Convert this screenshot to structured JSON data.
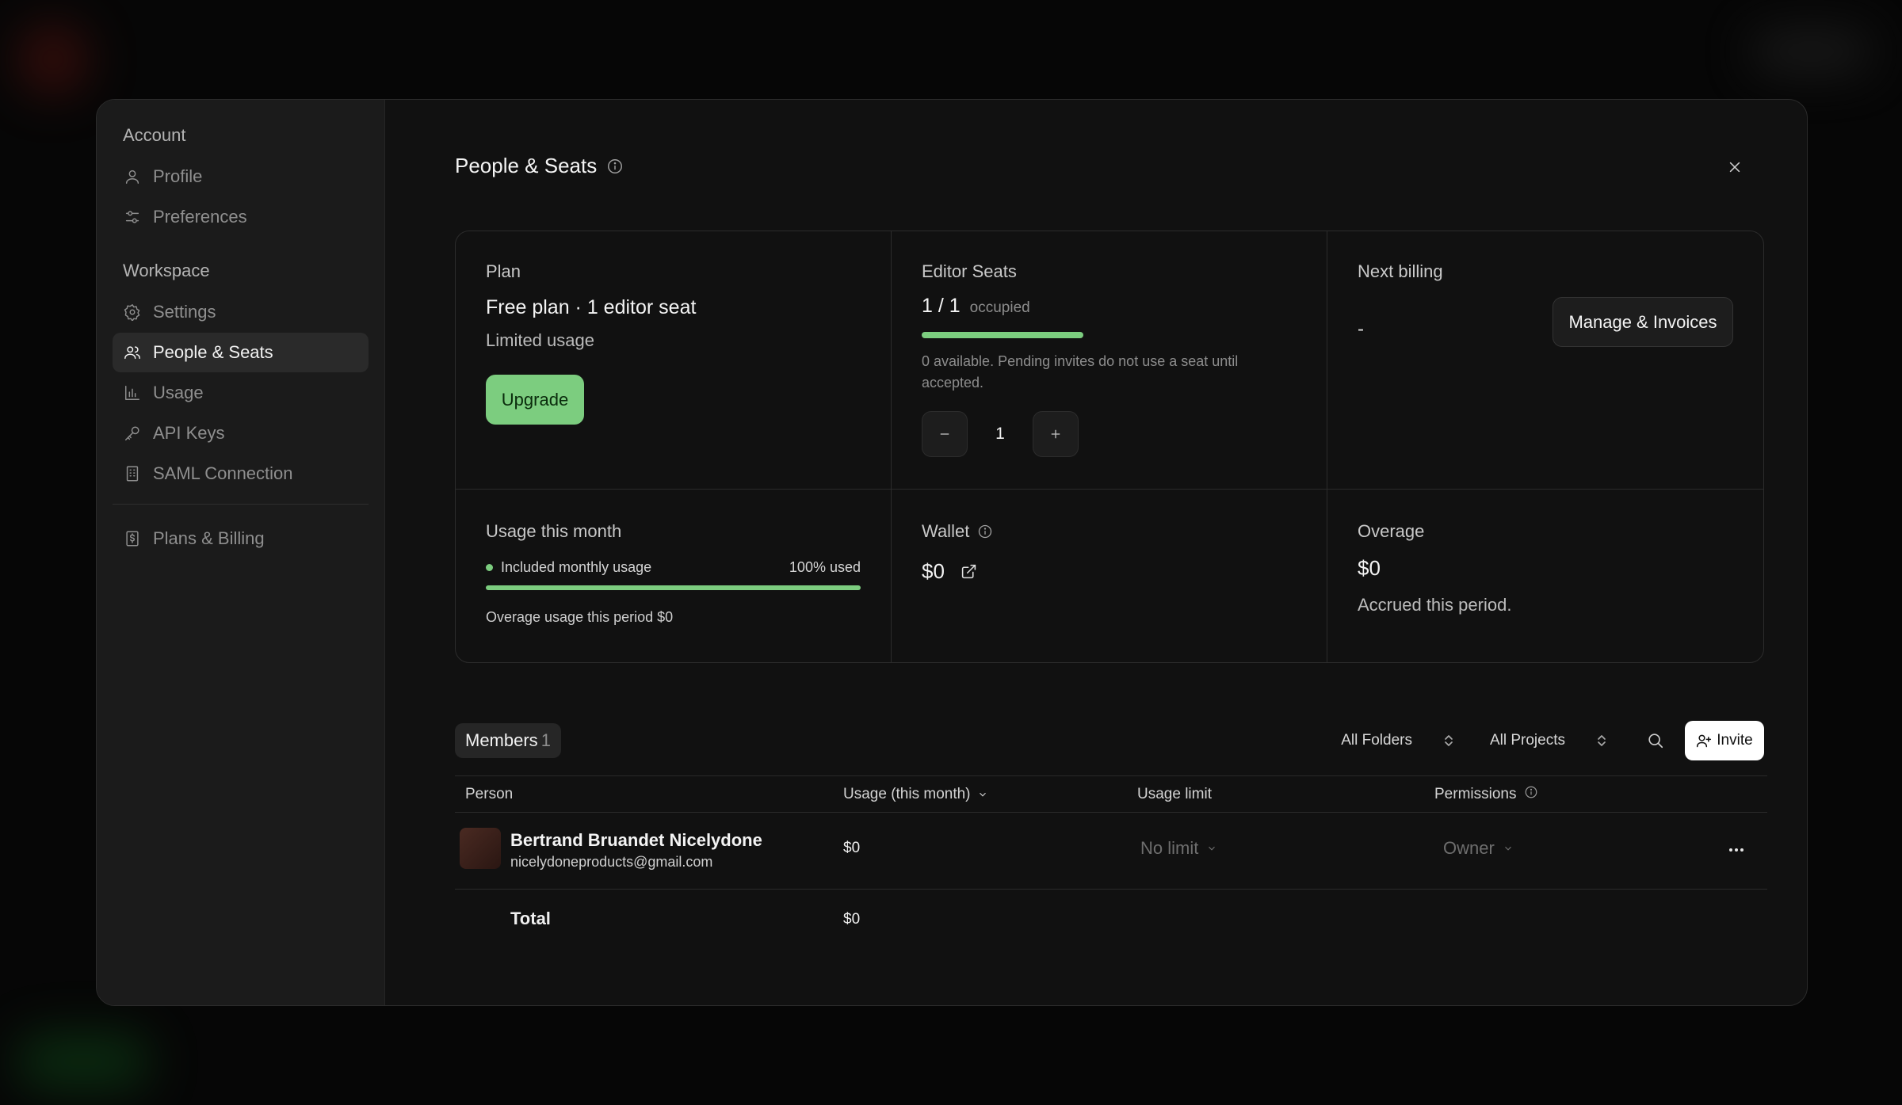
{
  "sidebar": {
    "account_heading": "Account",
    "workspace_heading": "Workspace",
    "account_items": [
      {
        "label": "Profile",
        "icon": "user-icon"
      },
      {
        "label": "Preferences",
        "icon": "sliders-icon"
      }
    ],
    "workspace_items": [
      {
        "label": "Settings",
        "icon": "gear-icon"
      },
      {
        "label": "People & Seats",
        "icon": "users-icon",
        "active": true
      },
      {
        "label": "Usage",
        "icon": "bar-chart-icon"
      },
      {
        "label": "API Keys",
        "icon": "key-icon"
      },
      {
        "label": "SAML Connection",
        "icon": "building-icon"
      }
    ],
    "billing_item": {
      "label": "Plans & Billing",
      "icon": "receipt-icon"
    }
  },
  "header": {
    "title": "People & Seats"
  },
  "plan": {
    "label": "Plan",
    "name": "Free plan · 1 editor seat",
    "sub": "Limited usage",
    "upgrade_label": "Upgrade"
  },
  "seats": {
    "label": "Editor Seats",
    "count": "1 / 1",
    "occupied": "occupied",
    "fill": 1.0,
    "note": "0 available. Pending invites do not use a seat until accepted.",
    "stepper_value": "1"
  },
  "billing": {
    "label": "Next billing",
    "value": "-",
    "manage_label": "Manage & Invoices"
  },
  "usage": {
    "label": "Usage this month",
    "included_label": "Included monthly usage",
    "used_label": "100% used",
    "used_fraction": 1.0,
    "overage_note": "Overage usage this period $0"
  },
  "wallet": {
    "label": "Wallet",
    "value": "$0"
  },
  "overage": {
    "label": "Overage",
    "value": "$0",
    "sub": "Accrued this period."
  },
  "members": {
    "tab_label": "Members",
    "count": "1",
    "folders_filter": "All Folders",
    "projects_filter": "All Projects",
    "invite_label": "Invite",
    "columns": {
      "person": "Person",
      "usage": "Usage (this month)",
      "limit": "Usage limit",
      "permissions": "Permissions"
    },
    "rows": [
      {
        "name": "Bertrand Bruandet Nicelydone",
        "email": "nicelydoneproducts@gmail.com",
        "usage": "$0",
        "limit": "No limit",
        "permission": "Owner"
      }
    ],
    "total_label": "Total",
    "total_value": "$0"
  },
  "colors": {
    "accent_green": "#7ccd7f",
    "panel": "#111111",
    "sidebar": "#1b1b1b"
  }
}
